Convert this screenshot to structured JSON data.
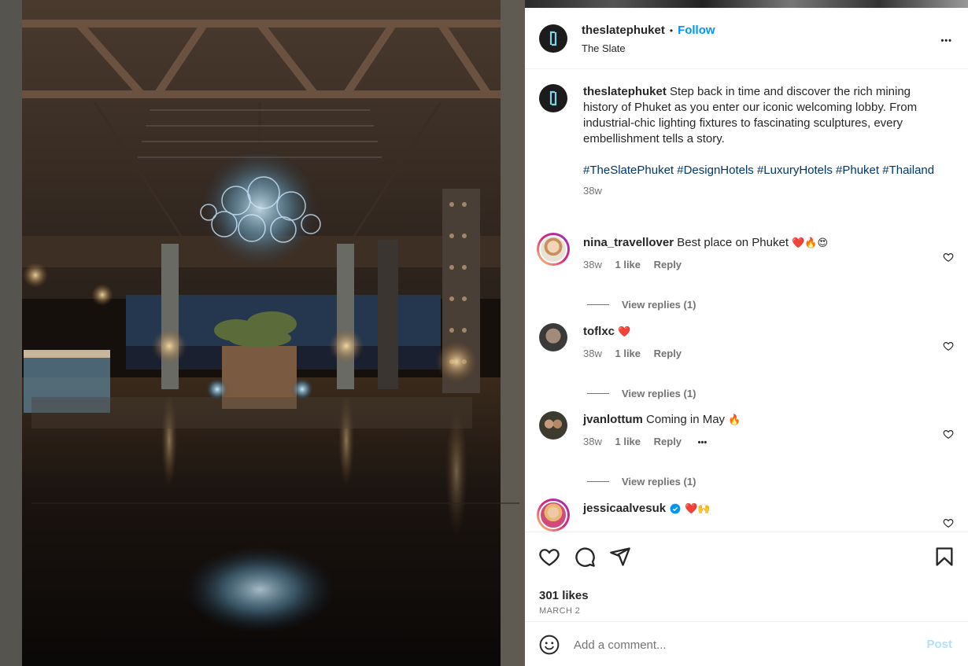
{
  "header": {
    "username": "theslatephuket",
    "dot": "•",
    "follow_label": "Follow",
    "location": "The Slate",
    "more": "•••"
  },
  "caption": {
    "username": "theslatephuket",
    "text": "Step back in time and discover the rich mining history of Phuket as you enter our iconic welcoming lobby. From industrial-chic lighting fixtures to fascinating sculptures, every embellishment tells a story.",
    "hashtags": "#TheSlatePhuket #DesignHotels #LuxuryHotels #Phuket #Thailand",
    "age": "38w"
  },
  "comments": [
    {
      "username": "nina_travellover",
      "text": "Best place on Phuket",
      "emojis": "❤️🔥😍",
      "age": "38w",
      "likes": "1 like",
      "reply": "Reply",
      "view_replies": "View replies (1)"
    },
    {
      "username": "toflxc",
      "text": "",
      "emojis": "❤️",
      "age": "38w",
      "likes": "1 like",
      "reply": "Reply",
      "view_replies": "View replies (1)"
    },
    {
      "username": "jvanlottum",
      "text": "Coming in May",
      "emojis": "🔥",
      "age": "38w",
      "likes": "1 like",
      "reply": "Reply",
      "more": "•••",
      "view_replies": "View replies (1)"
    },
    {
      "username": "jessicaalvesuk",
      "text": "",
      "emojis": "❤️🙌",
      "verified": true
    }
  ],
  "footer": {
    "likes": "301 likes",
    "date": "MARCH 2",
    "comment_placeholder": "Add a comment...",
    "post_label": "Post"
  },
  "colors": {
    "accent": "#0095f6",
    "hashtag": "#00376b",
    "muted": "#737373",
    "like_red": "#ed4956"
  },
  "icons": [
    "more-icon",
    "heart-icon",
    "comment-icon",
    "share-icon",
    "bookmark-icon",
    "emoji-icon",
    "verified-icon"
  ]
}
